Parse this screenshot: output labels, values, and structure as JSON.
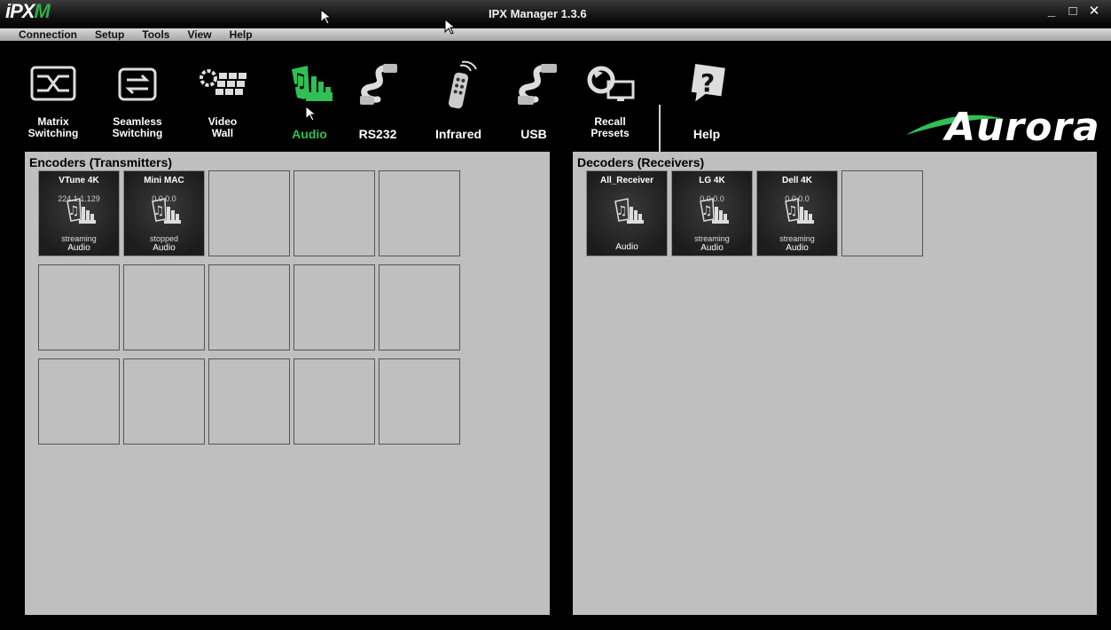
{
  "window": {
    "logo_ip": "iPX",
    "logo_m": "M",
    "title": "IPX Manager 1.3.6",
    "controls": [
      "_",
      "□",
      "✕"
    ]
  },
  "menu": [
    "Connection",
    "Setup",
    "Tools",
    "View",
    "Help"
  ],
  "toolbar": {
    "items": [
      {
        "label": "Matrix\nSwitching",
        "icon": "matrix-switching-icon"
      },
      {
        "label": "Seamless\nSwitching",
        "icon": "seamless-switching-icon"
      },
      {
        "label": "Video\nWall",
        "icon": "video-wall-icon"
      },
      {
        "label": "Audio",
        "icon": "audio-icon",
        "active": true
      },
      {
        "label": "RS232",
        "icon": "rs232-icon"
      },
      {
        "label": "Infrared",
        "icon": "infrared-remote-icon"
      },
      {
        "label": "USB",
        "icon": "usb-icon"
      },
      {
        "label": "Recall\nPresets",
        "icon": "recall-presets-icon"
      },
      {
        "label": "Help",
        "icon": "help-icon"
      }
    ],
    "brand": "Aurora",
    "accent": "#2fbf55"
  },
  "encoders": {
    "title": "Encoders (Transmitters)",
    "tiles": [
      {
        "name": "VTune 4K",
        "ip": "224.1.1.129",
        "status": "streaming",
        "type": "Audio"
      },
      {
        "name": "Mini MAC",
        "ip": "0.0.0.0",
        "status": "stopped",
        "type": "Audio"
      }
    ]
  },
  "decoders": {
    "title": "Decoders (Receivers)",
    "tiles": [
      {
        "name": "All_Receiver",
        "ip": "",
        "status": "",
        "type": "Audio"
      },
      {
        "name": "LG 4K",
        "ip": "0.0.0.0",
        "status": "streaming",
        "type": "Audio"
      },
      {
        "name": "Dell 4K",
        "ip": "0.0.0.0",
        "status": "streaming",
        "type": "Audio"
      }
    ]
  }
}
